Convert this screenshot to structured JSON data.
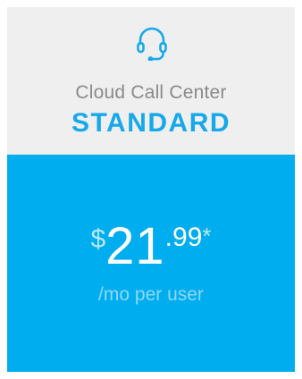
{
  "plan": {
    "icon": "headset-icon",
    "subtitle": "Cloud Call Center",
    "name": "STANDARD",
    "price": {
      "currency": "$",
      "whole": "21",
      "cents": ".99",
      "asterisk": "*",
      "period": "/mo per user"
    }
  },
  "colors": {
    "header_background": "#efefef",
    "accent": "#16a9e9",
    "body_background": "#00adef",
    "subtitle_text": "#8a8a8a"
  }
}
